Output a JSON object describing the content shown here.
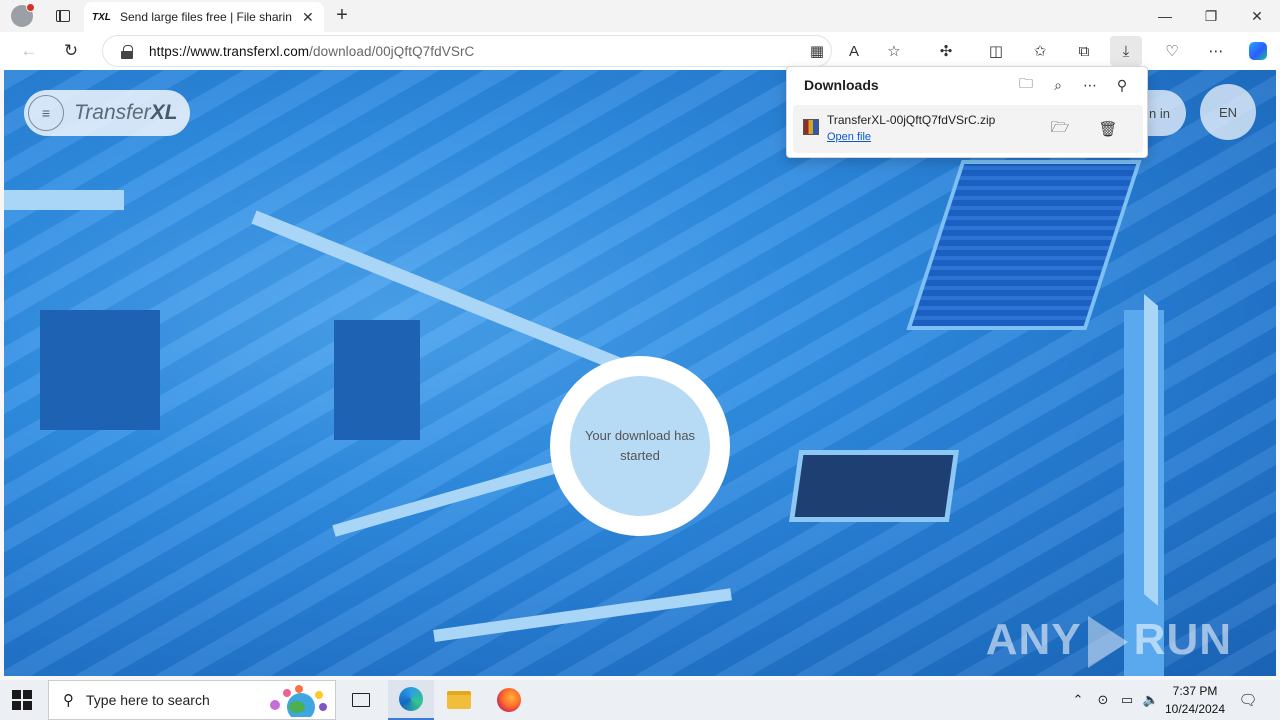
{
  "browser": {
    "tab_favicon": "TXL",
    "tab_title": "Send large files free | File sharing",
    "tab_close": "✕",
    "new_tab": "+",
    "window_controls": [
      "—",
      "❐",
      "✕"
    ],
    "url_host": "https://www.transferxl.com",
    "url_path": "/download/00jQftQ7fdVSrC",
    "nav": {
      "back": "←",
      "refresh": "↻"
    },
    "toolbar_icons": [
      "apps-icon",
      "read-aloud-icon",
      "favorite-star-icon",
      "extensions-icon",
      "split-screen-icon",
      "favorites-icon",
      "collections-icon",
      "downloads-icon",
      "browser-essentials-icon",
      "more-icon",
      "copilot-icon"
    ]
  },
  "page": {
    "logo_main": "Transfer",
    "logo_bold": "XL",
    "menu_glyph": "≡",
    "signin_partial": "n in",
    "language": "EN",
    "download_status": "Your download has started",
    "watermark_left": "ANY",
    "watermark_right": "RUN"
  },
  "downloads_flyout": {
    "title": "Downloads",
    "item": {
      "file_name": "TransferXL-00jQftQ7fdVSrC.zip",
      "action_link": "Open file"
    }
  },
  "taskbar": {
    "search_placeholder": "Type here to search",
    "time": "7:37 PM",
    "date": "10/24/2024",
    "apps": [
      "task-view-icon",
      "edge-icon",
      "file-explorer-icon",
      "firefox-icon"
    ],
    "tray_icons": [
      "chevron-up-icon",
      "meet-now-icon",
      "network-icon",
      "volume-icon",
      "notifications-icon"
    ]
  }
}
